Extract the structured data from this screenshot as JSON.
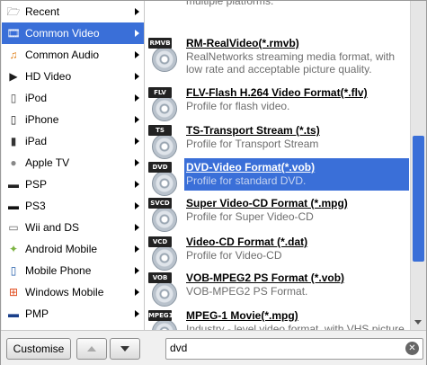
{
  "categories": [
    {
      "label": "Recent",
      "icon": "recent-folder-icon",
      "glyph": "🗁",
      "color": "#6b6b6b"
    },
    {
      "label": "Common Video",
      "icon": "film-icon",
      "glyph": "🎞",
      "color": "#2a4fb0",
      "selected": true
    },
    {
      "label": "Common Audio",
      "icon": "audio-icon",
      "glyph": "♫",
      "color": "#e07b10"
    },
    {
      "label": "HD Video",
      "icon": "hd-video-icon",
      "glyph": "▶",
      "color": "#1c1c1c"
    },
    {
      "label": "iPod",
      "icon": "ipod-icon",
      "glyph": "▯",
      "color": "#444"
    },
    {
      "label": "iPhone",
      "icon": "iphone-icon",
      "glyph": "▯",
      "color": "#222"
    },
    {
      "label": "iPad",
      "icon": "ipad-icon",
      "glyph": "▮",
      "color": "#333"
    },
    {
      "label": "Apple TV",
      "icon": "apple-icon",
      "glyph": "●",
      "color": "#888"
    },
    {
      "label": "PSP",
      "icon": "psp-icon",
      "glyph": "▬",
      "color": "#222"
    },
    {
      "label": "PS3",
      "icon": "ps3-icon",
      "glyph": "▬",
      "color": "#111"
    },
    {
      "label": "Wii and DS",
      "icon": "wii-icon",
      "glyph": "▭",
      "color": "#666"
    },
    {
      "label": "Android Mobile",
      "icon": "android-icon",
      "glyph": "✦",
      "color": "#7cb342"
    },
    {
      "label": "Mobile Phone",
      "icon": "mobile-phone-icon",
      "glyph": "▯",
      "color": "#1e5aa8"
    },
    {
      "label": "Windows Mobile",
      "icon": "windows-icon",
      "glyph": "⊞",
      "color": "#e04a1a"
    },
    {
      "label": "PMP",
      "icon": "pmp-icon",
      "glyph": "▬",
      "color": "#1a3f8a"
    }
  ],
  "formats": [
    {
      "badge": "",
      "title": "",
      "desc": "network transmission, and compatible with multiple platforms."
    },
    {
      "badge": "RMVB",
      "title": "RM-RealVideo(*.rmvb)",
      "desc": "RealNetworks streaming media format, with low rate and acceptable picture quality."
    },
    {
      "badge": "FLV",
      "title": "FLV-Flash H.264 Video Format(*.flv)",
      "desc": "Profile for flash video."
    },
    {
      "badge": "TS",
      "title": "TS-Transport Stream (*.ts)",
      "desc": "Profile for Transport Stream"
    },
    {
      "badge": "DVD",
      "title": "DVD-Video Format(*.vob)",
      "desc": "Profile for standard DVD.",
      "selected": true
    },
    {
      "badge": "SVCD",
      "title": "Super Video-CD Format (*.mpg)",
      "desc": "Profile for Super Video-CD"
    },
    {
      "badge": "VCD",
      "title": "Video-CD Format (*.dat)",
      "desc": "Profile for Video-CD"
    },
    {
      "badge": "VOB",
      "title": "VOB-MPEG2 PS Format (*.vob)",
      "desc": "VOB-MPEG2 PS Format."
    },
    {
      "badge": "MPEG1",
      "title": "MPEG-1 Movie(*.mpg)",
      "desc": "Industry - level video format, with VHS picture"
    }
  ],
  "bottom": {
    "customise_label": "Customise",
    "search_value": "dvd",
    "clear_glyph": "✕"
  }
}
